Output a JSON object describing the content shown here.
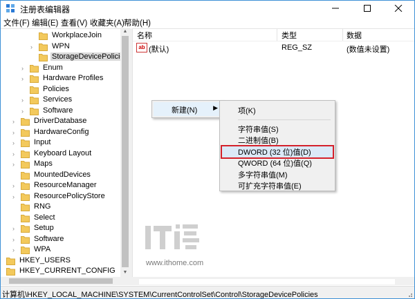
{
  "window": {
    "title": "注册表编辑器",
    "controls": {
      "minimize": "minimize",
      "maximize": "maximize",
      "close": "close"
    }
  },
  "menu": [
    "文件(F)",
    "编辑(E)",
    "查看(V)",
    "收藏夹(A)",
    "帮助(H)"
  ],
  "tree": [
    {
      "label": "WorkplaceJoin",
      "indent": 2,
      "arrow": false
    },
    {
      "label": "WPN",
      "indent": 2,
      "arrow": true
    },
    {
      "label": "StorageDevicePolicies",
      "indent": 2,
      "arrow": false,
      "selected": true
    },
    {
      "label": "Enum",
      "indent": 1,
      "arrow": true
    },
    {
      "label": "Hardware Profiles",
      "indent": 1,
      "arrow": true
    },
    {
      "label": "Policies",
      "indent": 1,
      "arrow": false
    },
    {
      "label": "Services",
      "indent": 1,
      "arrow": true
    },
    {
      "label": "Software",
      "indent": 1,
      "arrow": true
    },
    {
      "label": "DriverDatabase",
      "indent": 0,
      "arrow": true
    },
    {
      "label": "HardwareConfig",
      "indent": 0,
      "arrow": true
    },
    {
      "label": "Input",
      "indent": 0,
      "arrow": true
    },
    {
      "label": "Keyboard Layout",
      "indent": 0,
      "arrow": true
    },
    {
      "label": "Maps",
      "indent": 0,
      "arrow": true
    },
    {
      "label": "MountedDevices",
      "indent": 0,
      "arrow": false
    },
    {
      "label": "ResourceManager",
      "indent": 0,
      "arrow": true
    },
    {
      "label": "ResourcePolicyStore",
      "indent": 0,
      "arrow": true
    },
    {
      "label": "RNG",
      "indent": 0,
      "arrow": false
    },
    {
      "label": "Select",
      "indent": 0,
      "arrow": false
    },
    {
      "label": "Setup",
      "indent": 0,
      "arrow": true
    },
    {
      "label": "Software",
      "indent": 0,
      "arrow": true
    },
    {
      "label": "WPA",
      "indent": 0,
      "arrow": true
    },
    {
      "label": "HKEY_USERS",
      "indent": -1,
      "arrow": true
    },
    {
      "label": "HKEY_CURRENT_CONFIG",
      "indent": -1,
      "arrow": true
    }
  ],
  "list": {
    "columns": [
      "名称",
      "类型",
      "数据"
    ],
    "rows": [
      {
        "name": "(默认)",
        "type": "REG_SZ",
        "data": "(数值未设置)",
        "icon": "ab-string-icon",
        "icon_text": "ab"
      }
    ]
  },
  "context_menu": {
    "new_label": "新建(N)",
    "submenu": [
      {
        "label": "项(K)"
      },
      {
        "sep": true
      },
      {
        "label": "字符串值(S)"
      },
      {
        "label": "二进制值(B)"
      },
      {
        "label": "DWORD (32 位)值(D)",
        "highlighted": true
      },
      {
        "label": "QWORD (64 位)值(Q)"
      },
      {
        "label": "多字符串值(M)"
      },
      {
        "label": "可扩充字符串值(E)"
      }
    ]
  },
  "watermark": {
    "url": "www.ithome.com"
  },
  "status": {
    "path": "计算机\\HKEY_LOCAL_MACHINE\\SYSTEM\\CurrentControlSet\\Control\\StorageDevicePolicies"
  },
  "colors": {
    "accent": "#3c8fd6",
    "highlight_border": "#d4202a",
    "folder": "#f3c95c"
  }
}
